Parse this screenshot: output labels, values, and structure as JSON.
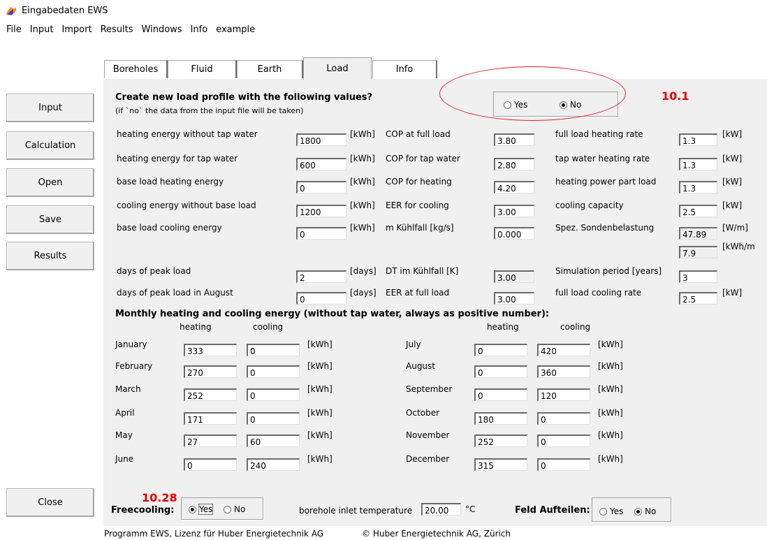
{
  "window": {
    "title": "Eingabedaten EWS",
    "icon": "flame-app-icon"
  },
  "menu": [
    "File",
    "Input",
    "Import",
    "Results",
    "Windows",
    "Info",
    "example"
  ],
  "side_buttons": {
    "input": "Input",
    "calculation": "Calculation",
    "open": "Open",
    "save": "Save",
    "results": "Results",
    "close": "Close"
  },
  "tabs": [
    "Boreholes",
    "Fluid",
    "Earth",
    "Load",
    "Info"
  ],
  "active_tab": "Load",
  "header": {
    "question": "Create new load profile with the following values?",
    "note": "(if `no` the data from the input file will be taken)",
    "yes": "Yes",
    "no": "No",
    "selected": "No"
  },
  "annotations": {
    "a1": "10.1",
    "a2": "10.28"
  },
  "col1": [
    {
      "label": "heating energy without tap water",
      "value": "1800",
      "unit": "[kWh]"
    },
    {
      "label": "heating energy for tap water",
      "value": "600",
      "unit": "[kWh]"
    },
    {
      "label": "base load heating energy",
      "value": "0",
      "unit": "[kWh]"
    },
    {
      "label": "cooling energy without base load",
      "value": "1200",
      "unit": "[kWh]"
    },
    {
      "label": "base load cooling energy",
      "value": "0",
      "unit": "[kWh]"
    },
    {
      "label": "days of peak load",
      "value": "2",
      "unit": "[days]"
    },
    {
      "label": "days of peak load in August",
      "value": "0",
      "unit": "[days]"
    }
  ],
  "col2": [
    {
      "label": "COP at full load",
      "value": "3.80"
    },
    {
      "label": "COP for tap water",
      "value": "2.80"
    },
    {
      "label": "COP for heating",
      "value": "4.20"
    },
    {
      "label": "EER for cooling",
      "value": "3.00"
    },
    {
      "label": "m Kühlfall [kg/s]",
      "value": "0.000"
    },
    {
      "label": "DT im Kühlfall [K]",
      "value": "3.00"
    },
    {
      "label": "EER at full load",
      "value": "3.00"
    }
  ],
  "col3": [
    {
      "label": "full load heating rate",
      "value": "1.3",
      "unit": "[kW]"
    },
    {
      "label": "tap water heating rate",
      "value": "1.3",
      "unit": "[kW]"
    },
    {
      "label": "heating power part load",
      "value": "1.3",
      "unit": "[kW]"
    },
    {
      "label": "cooling capacity",
      "value": "2.5",
      "unit": "[kW]"
    },
    {
      "label": "Spez. Sondenbelastung",
      "value": "47.89",
      "unit": "[W/m]"
    },
    {
      "label": "",
      "value": "7.9",
      "unit": "[kWh/m"
    },
    {
      "label": "Simulation period [years]",
      "value": "3",
      "unit": ""
    },
    {
      "label": "full load cooling rate",
      "value": "2.5",
      "unit": "[kW]"
    }
  ],
  "monthly": {
    "title": "Monthly heating and cooling energy (without tap water, always as positive number):",
    "heating": "heating",
    "cooling": "cooling",
    "left": [
      {
        "month": "January",
        "heating": "333",
        "cooling": "0",
        "unit": "[kWh]"
      },
      {
        "month": "February",
        "heating": "270",
        "cooling": "0",
        "unit": "[kWh]"
      },
      {
        "month": "March",
        "heating": "252",
        "cooling": "0",
        "unit": "[kWh]"
      },
      {
        "month": "April",
        "heating": "171",
        "cooling": "0",
        "unit": "[kWh]"
      },
      {
        "month": "May",
        "heating": "27",
        "cooling": "60",
        "unit": "[kWh]"
      },
      {
        "month": "June",
        "heating": "0",
        "cooling": "240",
        "unit": "[kWh]"
      }
    ],
    "right": [
      {
        "month": "July",
        "heating": "0",
        "cooling": "420",
        "unit": "[kWh]"
      },
      {
        "month": "August",
        "heating": "0",
        "cooling": "360",
        "unit": "[kWh]"
      },
      {
        "month": "September",
        "heating": "0",
        "cooling": "120",
        "unit": "[kWh]"
      },
      {
        "month": "October",
        "heating": "180",
        "cooling": "0",
        "unit": "[kWh]"
      },
      {
        "month": "November",
        "heating": "252",
        "cooling": "0",
        "unit": "[kWh]"
      },
      {
        "month": "December",
        "heating": "315",
        "cooling": "0",
        "unit": "[kWh]"
      }
    ]
  },
  "footer": {
    "freecooling": "Freecooling:",
    "fc_yes": "Yes",
    "fc_no": "No",
    "fc_selected": "Yes",
    "inlet_label": "borehole inlet temperature",
    "inlet_value": "20.00",
    "inlet_unit": "°C",
    "feld": "Feld Aufteilen:",
    "feld_yes": "Yes",
    "feld_no": "No",
    "feld_selected": "No"
  },
  "status": {
    "license": "Programm EWS, Lizenz für Huber Energietechnik AG",
    "copyright": "© Huber Energietechnik AG, Zürich"
  },
  "colors": {
    "annotation": "#e60000",
    "panel": "#f0f0f0"
  }
}
